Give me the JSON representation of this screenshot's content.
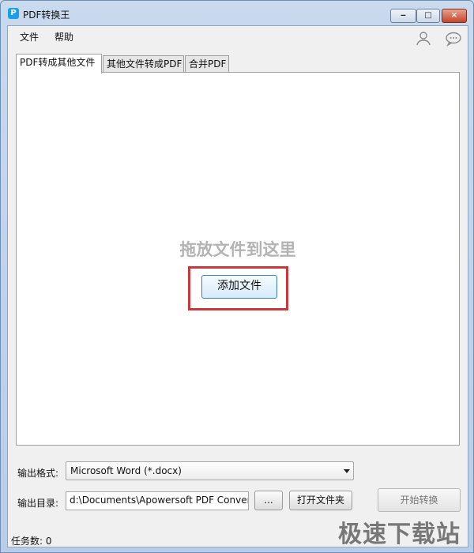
{
  "window": {
    "app_logo": "P",
    "title": "PDF转换王",
    "controls": {
      "minimize": "‒",
      "maximize": "□",
      "close": "×"
    }
  },
  "menu": {
    "file": "文件",
    "help": "帮助",
    "icons": [
      "user-icon",
      "chat-icon"
    ]
  },
  "tabs": [
    {
      "label": "PDF转成其他文件",
      "active": true
    },
    {
      "label": "其他文件转成PDF",
      "active": false
    },
    {
      "label": "合并PDF",
      "active": false
    }
  ],
  "panel": {
    "drop_hint": "拖放文件到这里",
    "add_file_button": "添加文件"
  },
  "output": {
    "format_label": "输出格式:",
    "format_value": "Microsoft Word (*.docx)",
    "dir_label": "输出目录:",
    "dir_value": "d:\\Documents\\Apowersoft PDF Convert",
    "browse_button": "...",
    "open_folder_button": "打开文件夹",
    "start_button": "开始转换"
  },
  "status": {
    "task_count": "任务数: 0"
  },
  "watermark": "极速下载站",
  "colors": {
    "highlight": "#c8383c",
    "title_bar": "#c9d9ee"
  }
}
